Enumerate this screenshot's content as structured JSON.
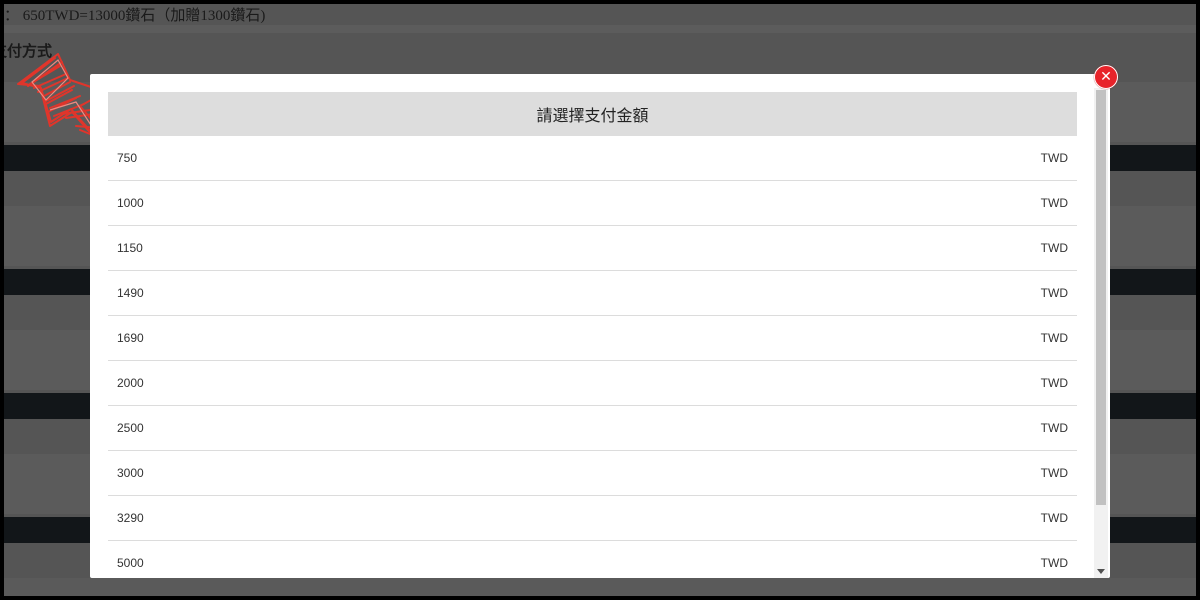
{
  "background": {
    "price_note": "：  650TWD=13000鑽石（加贈1300鑽石)",
    "payment_section_title": "支付方式"
  },
  "modal": {
    "title": "請選擇支付金額",
    "close_icon": "close-icon",
    "options": [
      {
        "amount": "750",
        "currency": "TWD"
      },
      {
        "amount": "1000",
        "currency": "TWD"
      },
      {
        "amount": "1150",
        "currency": "TWD"
      },
      {
        "amount": "1490",
        "currency": "TWD"
      },
      {
        "amount": "1690",
        "currency": "TWD"
      },
      {
        "amount": "2000",
        "currency": "TWD"
      },
      {
        "amount": "2500",
        "currency": "TWD"
      },
      {
        "amount": "3000",
        "currency": "TWD"
      },
      {
        "amount": "3290",
        "currency": "TWD"
      },
      {
        "amount": "5000",
        "currency": "TWD"
      }
    ]
  },
  "colors": {
    "overlay": "#555555",
    "header_bg": "#dddddd",
    "close_button": "#e8232a",
    "annotation_arrow": "#e0352b"
  }
}
